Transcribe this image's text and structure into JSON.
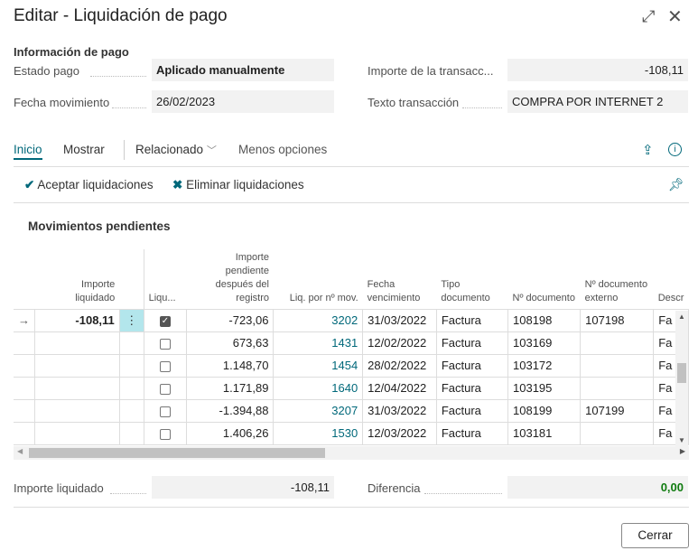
{
  "dialog": {
    "title": "Editar - Liquidación de pago",
    "expand_icon": "expand-icon",
    "close_icon": "close-icon"
  },
  "info": {
    "section_title": "Información de pago",
    "estado_label": "Estado pago",
    "estado_value": "Aplicado manualmente",
    "fecha_label": "Fecha movimiento",
    "fecha_value": "26/02/2023",
    "importe_label": "Importe de la transacc...",
    "importe_value": "-108,11",
    "texto_label": "Texto transacción",
    "texto_value": "COMPRA POR INTERNET 2"
  },
  "tabs": [
    {
      "label": "Inicio",
      "active": true
    },
    {
      "label": "Mostrar"
    },
    {
      "label": "Relacionado"
    },
    {
      "label": "Menos opciones"
    }
  ],
  "actions": {
    "accept": "Aceptar liquidaciones",
    "remove": "Eliminar liquidaciones"
  },
  "grid": {
    "title": "Movimientos pendientes",
    "headers": [
      "Importe liquidado",
      "Liqu...",
      "Importe pendiente después del registro",
      "Liq. por nº mov.",
      "Fecha vencimiento",
      "Tipo documento",
      "Nº documento",
      "Nº documento externo",
      "Descr"
    ],
    "rows": [
      {
        "importe": "-108,11",
        "checked": true,
        "pendiente": "-723,06",
        "mov": "3202",
        "fecha": "31/03/2022",
        "tipo": "Factura",
        "doc": "108198",
        "ext": "107198",
        "desc": "Fa"
      },
      {
        "importe": "",
        "checked": false,
        "pendiente": "673,63",
        "mov": "1431",
        "fecha": "12/02/2022",
        "tipo": "Factura",
        "doc": "103169",
        "ext": "",
        "desc": "Fa"
      },
      {
        "importe": "",
        "checked": false,
        "pendiente": "1.148,70",
        "mov": "1454",
        "fecha": "28/02/2022",
        "tipo": "Factura",
        "doc": "103172",
        "ext": "",
        "desc": "Fa"
      },
      {
        "importe": "",
        "checked": false,
        "pendiente": "1.171,89",
        "mov": "1640",
        "fecha": "12/04/2022",
        "tipo": "Factura",
        "doc": "103195",
        "ext": "",
        "desc": "Fa"
      },
      {
        "importe": "",
        "checked": false,
        "pendiente": "-1.394,88",
        "mov": "3207",
        "fecha": "31/03/2022",
        "tipo": "Factura",
        "doc": "108199",
        "ext": "107199",
        "desc": "Fa"
      },
      {
        "importe": "",
        "checked": false,
        "pendiente": "1.406,26",
        "mov": "1530",
        "fecha": "12/03/2022",
        "tipo": "Factura",
        "doc": "103181",
        "ext": "",
        "desc": "Fa"
      }
    ]
  },
  "footer": {
    "importe_label": "Importe liquidado",
    "importe_value": "-108,11",
    "dif_label": "Diferencia",
    "dif_value": "0,00",
    "close": "Cerrar"
  },
  "colors": {
    "accent": "#00687a",
    "selected_cell": "#b3e6ec",
    "positive": "#107c10"
  }
}
